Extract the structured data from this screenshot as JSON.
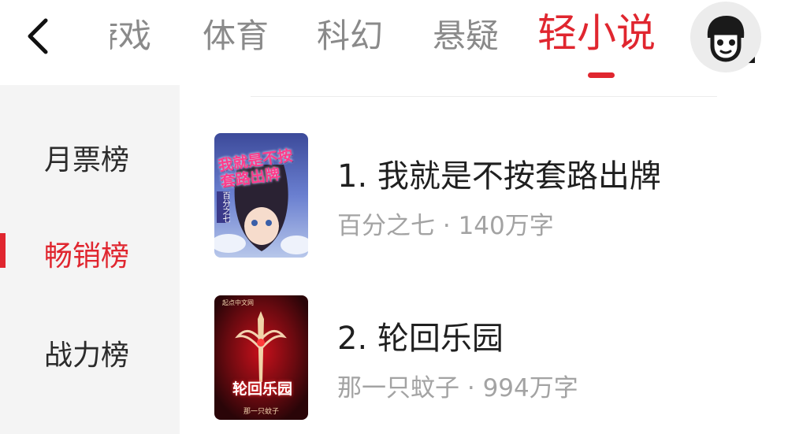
{
  "header": {
    "tabs": [
      {
        "label": "游戏"
      },
      {
        "label": "体育"
      },
      {
        "label": "科幻"
      },
      {
        "label": "悬疑"
      },
      {
        "label": "轻小说"
      }
    ],
    "active_tab": "轻小说"
  },
  "sidebar": {
    "items": [
      {
        "label": "月票榜"
      },
      {
        "label": "畅销榜"
      },
      {
        "label": "战力榜"
      }
    ],
    "active_item": "畅销榜"
  },
  "books": [
    {
      "rank_title": "1. 我就是不按套路出牌",
      "author": "百分之七",
      "separator": "·",
      "word_count": "140万字",
      "cover_title": "我就是不按套路出牌",
      "cover_author": "百分之七"
    },
    {
      "rank_title": "2. 轮回乐园",
      "author": "那一只蚊子",
      "separator": "·",
      "word_count": "994万字",
      "cover_title": "轮回乐园",
      "cover_author": "那一只蚊子",
      "cover_publisher": "起点中文网"
    }
  ],
  "colors": {
    "accent": "#e0262f",
    "sidebar_bg": "#f4f4f4"
  }
}
